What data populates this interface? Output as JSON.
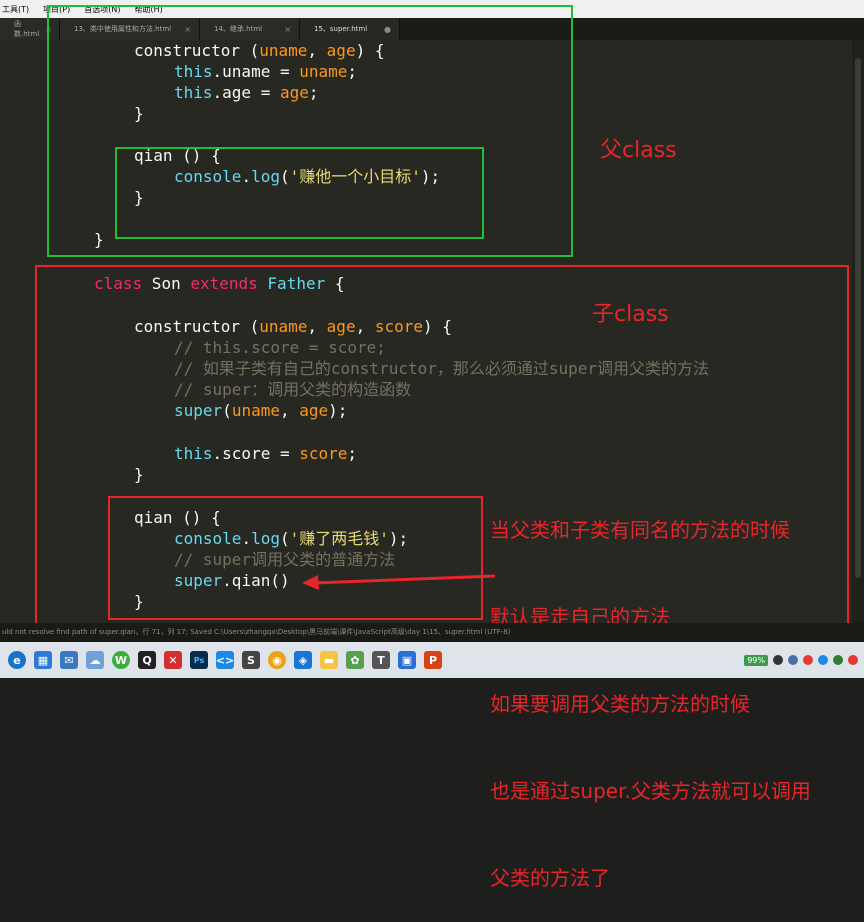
{
  "menubar": {
    "items": [
      "工具(T)",
      "项目(P)",
      "首选项(N)",
      "帮助(H)"
    ]
  },
  "tabs": [
    {
      "label": "函数.html",
      "active": false
    },
    {
      "label": "13、类中使用属性和方法.html",
      "active": false
    },
    {
      "label": "14、继承.html",
      "active": false
    },
    {
      "label": "15、super.html",
      "active": true
    }
  ],
  "code": {
    "l1": {
      "a": "constructor (",
      "b": "uname",
      "c": ", ",
      "d": "age",
      "e": ") {"
    },
    "l2": {
      "a": "this",
      "b": ".uname = ",
      "c": "uname",
      "d": ";"
    },
    "l3": {
      "a": "this",
      "b": ".age = ",
      "c": "age",
      "d": ";"
    },
    "l4": "}",
    "l5": "qian () {",
    "l6": {
      "a": "console",
      "b": ".",
      "c": "log",
      "d": "(",
      "e": "'赚他一个小目标'",
      "f": ");"
    },
    "l7": "}",
    "l8": "}",
    "l9": {
      "a": "class",
      "b": " Son ",
      "c": "extends",
      "d": " ",
      "e": "Father",
      "f": " {"
    },
    "l10": {
      "a": "constructor (",
      "b": "uname",
      "c": ", ",
      "d": "age",
      "e": ", ",
      "f": "score",
      "g": ") {"
    },
    "l11": "// this.score = score;",
    "l12": "// 如果子类有自己的constructor，那么必须通过super调用父类的方法",
    "l13": "// super：调用父类的构造函数",
    "l14": {
      "a": "super",
      "b": "(",
      "c": "uname",
      "d": ", ",
      "e": "age",
      "f": ");"
    },
    "l15": {
      "a": "this",
      "b": ".score = ",
      "c": "score",
      "d": ";"
    },
    "l16": "}",
    "l17": "qian () {",
    "l18": {
      "a": "console",
      "b": ".",
      "c": "log",
      "d": "(",
      "e": "'赚了两毛钱'",
      "f": ");"
    },
    "l19": "// super调用父类的普通方法",
    "l20": {
      "a": "super",
      "b": ".qian()"
    },
    "l21": "}"
  },
  "annotations": {
    "father_label": "父class",
    "son_label": "子class",
    "explanation": [
      "当父类和子类有同名的方法的时候",
      "默认是走自己的方法",
      "如果要调用父类的方法的时候",
      "也是通过super.父类方法就可以调用",
      "父类的方法了"
    ]
  },
  "colors": {
    "green_box": "#1fbd3a",
    "red_box": "#e8252a"
  },
  "statusbar": {
    "text": "uld not resolve find path of super.qian，行 71，列 17; Saved C:\\Users\\zhangqx\\Desktop\\黑马前端\\课件\\JavaScript高级\\day 1\\15、super.html (UTF-8)"
  },
  "taskbar": {
    "battery": "99%"
  }
}
